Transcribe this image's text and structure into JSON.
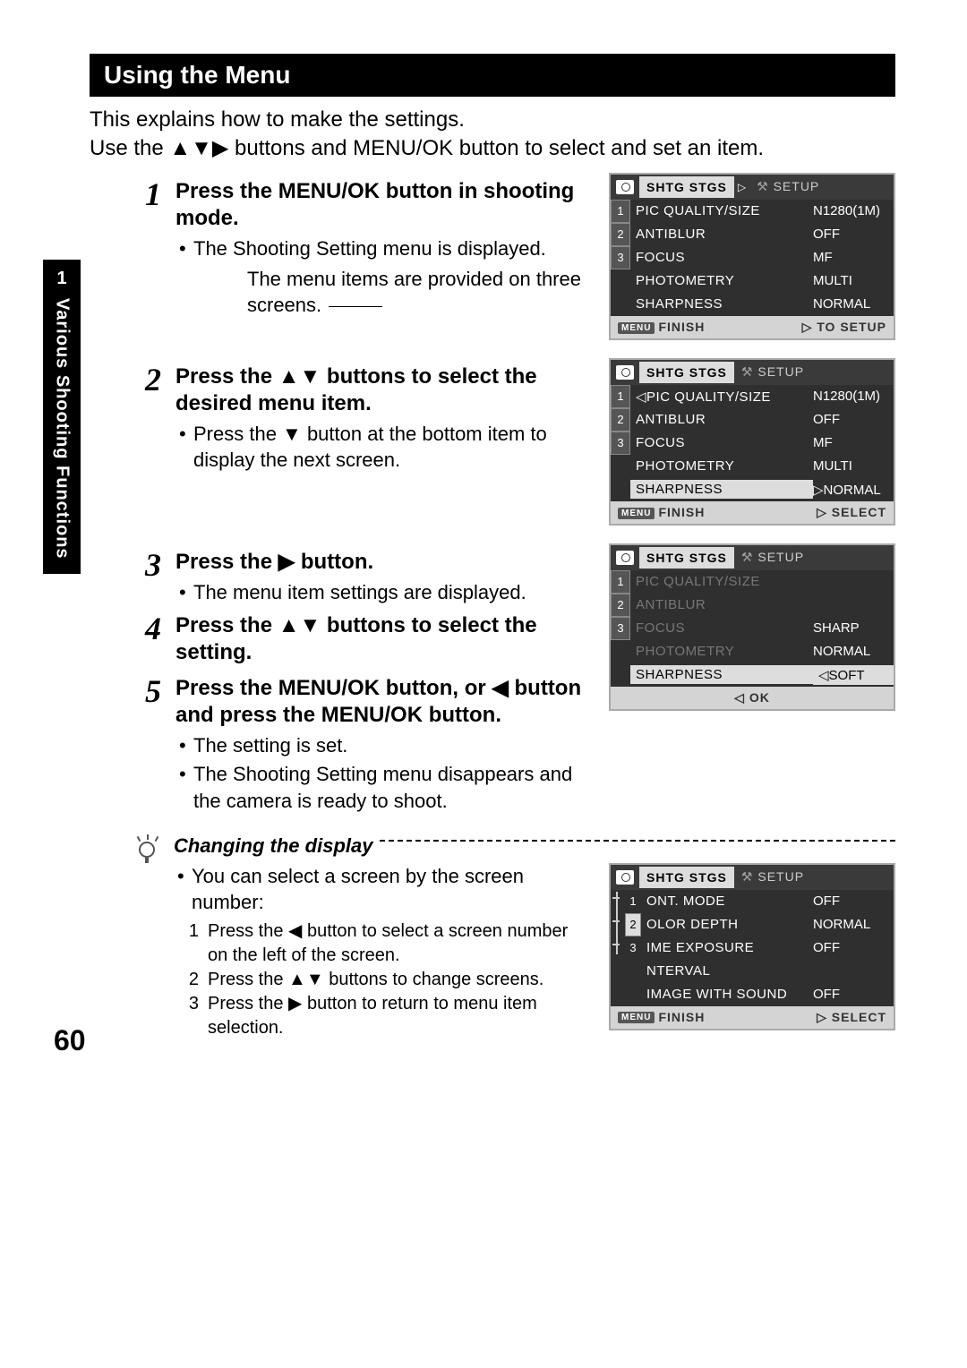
{
  "page_number": "60",
  "side_tab": {
    "number": "1",
    "label": "Various Shooting Functions"
  },
  "section_title": "Using the Menu",
  "intro_line1": "This explains how to make the settings.",
  "intro_line2_a": "Use the ",
  "intro_line2_tri": "▲▼▶",
  "intro_line2_b": " buttons and MENU/OK button to select and set an item.",
  "steps": {
    "s1": {
      "title": "Press the MENU/OK button in shooting mode.",
      "b1": "The Shooting Setting menu is displayed.",
      "caption": "The menu items are provided on three screens."
    },
    "s2": {
      "title_a": "Press the ",
      "title_tri": "▲▼",
      "title_b": " buttons to select the desired menu item.",
      "b1_a": "Press the ",
      "b1_tri": "▼",
      "b1_b": " button at the bottom item to display the next screen."
    },
    "s3": {
      "title_a": "Press the ",
      "title_tri": "▶",
      "title_b": " button.",
      "b1": "The menu item settings are displayed."
    },
    "s4": {
      "title_a": "Press the ",
      "title_tri": "▲▼",
      "title_b": " buttons to select the setting."
    },
    "s5": {
      "title_a": "Press the MENU/OK button, or ",
      "title_tri": "◀",
      "title_b": " button and press the MENU/OK button.",
      "b1": "The setting is set.",
      "b2": "The Shooting Setting menu disappears and the camera is ready to shoot."
    }
  },
  "tip": {
    "heading": "Changing the display",
    "b1": "You can select a screen by the screen number:",
    "n1_a": "Press the ",
    "n1_tri": "◀",
    "n1_b": " button to select a screen number on the left of the screen.",
    "n2_a": "Press the ",
    "n2_tri": "▲▼",
    "n2_b": " buttons to change screens.",
    "n3_a": "Press the ",
    "n3_tri": "▶",
    "n3_b": " button to return to menu item selection."
  },
  "lcd_common": {
    "tab_active": "SHTG STGS",
    "tab_inactive": "SETUP",
    "menu_badge": "MENU",
    "finish": "FINISH",
    "to_setup": "▷ TO SETUP",
    "select": "▷ SELECT",
    "ok": "◁ OK"
  },
  "lcd1": {
    "rows": [
      {
        "idx": "1",
        "label": "PIC QUALITY/SIZE",
        "val": "N1280(1M)"
      },
      {
        "idx": "2",
        "label": "ANTIBLUR",
        "val": "OFF"
      },
      {
        "idx": "3",
        "label": "FOCUS",
        "val": "MF"
      },
      {
        "idx": "",
        "label": "PHOTOMETRY",
        "val": "MULTI"
      },
      {
        "idx": "",
        "label": "SHARPNESS",
        "val": "NORMAL"
      }
    ]
  },
  "lcd2": {
    "rows": [
      {
        "idx": "1",
        "label": "PIC QUALITY/SIZE",
        "val": "N1280(1M)",
        "label_hl": false
      },
      {
        "idx": "2",
        "label": "ANTIBLUR",
        "val": "OFF"
      },
      {
        "idx": "3",
        "label": "FOCUS",
        "val": "MF"
      },
      {
        "idx": "",
        "label": "PHOTOMETRY",
        "val": "MULTI"
      },
      {
        "idx": "",
        "label": "SHARPNESS",
        "val": "NORMAL",
        "label_hl": true,
        "val_prefix": "▷"
      }
    ]
  },
  "lcd3": {
    "rows_left": [
      {
        "idx": "1",
        "label": "PIC QUALITY/SIZE"
      },
      {
        "idx": "2",
        "label": "ANTIBLUR"
      },
      {
        "idx": "3",
        "label": "FOCUS"
      },
      {
        "idx": "",
        "label": "PHOTOMETRY"
      },
      {
        "idx": "",
        "label": "SHARPNESS",
        "hl": true
      }
    ],
    "options": [
      {
        "val": "SHARP"
      },
      {
        "val": "NORMAL"
      },
      {
        "val": "SOFT",
        "hl": true,
        "prefix": "◁"
      }
    ]
  },
  "lcd4": {
    "rows": [
      {
        "label": "ONT. MODE",
        "val": "OFF"
      },
      {
        "label": "OLOR DEPTH",
        "val": "NORMAL"
      },
      {
        "label": "IME EXPOSURE",
        "val": "OFF"
      },
      {
        "label": "NTERVAL",
        "val": ""
      },
      {
        "label": "IMAGE WITH SOUND",
        "val": "OFF"
      }
    ],
    "idx": [
      "1",
      "2",
      "3"
    ]
  }
}
